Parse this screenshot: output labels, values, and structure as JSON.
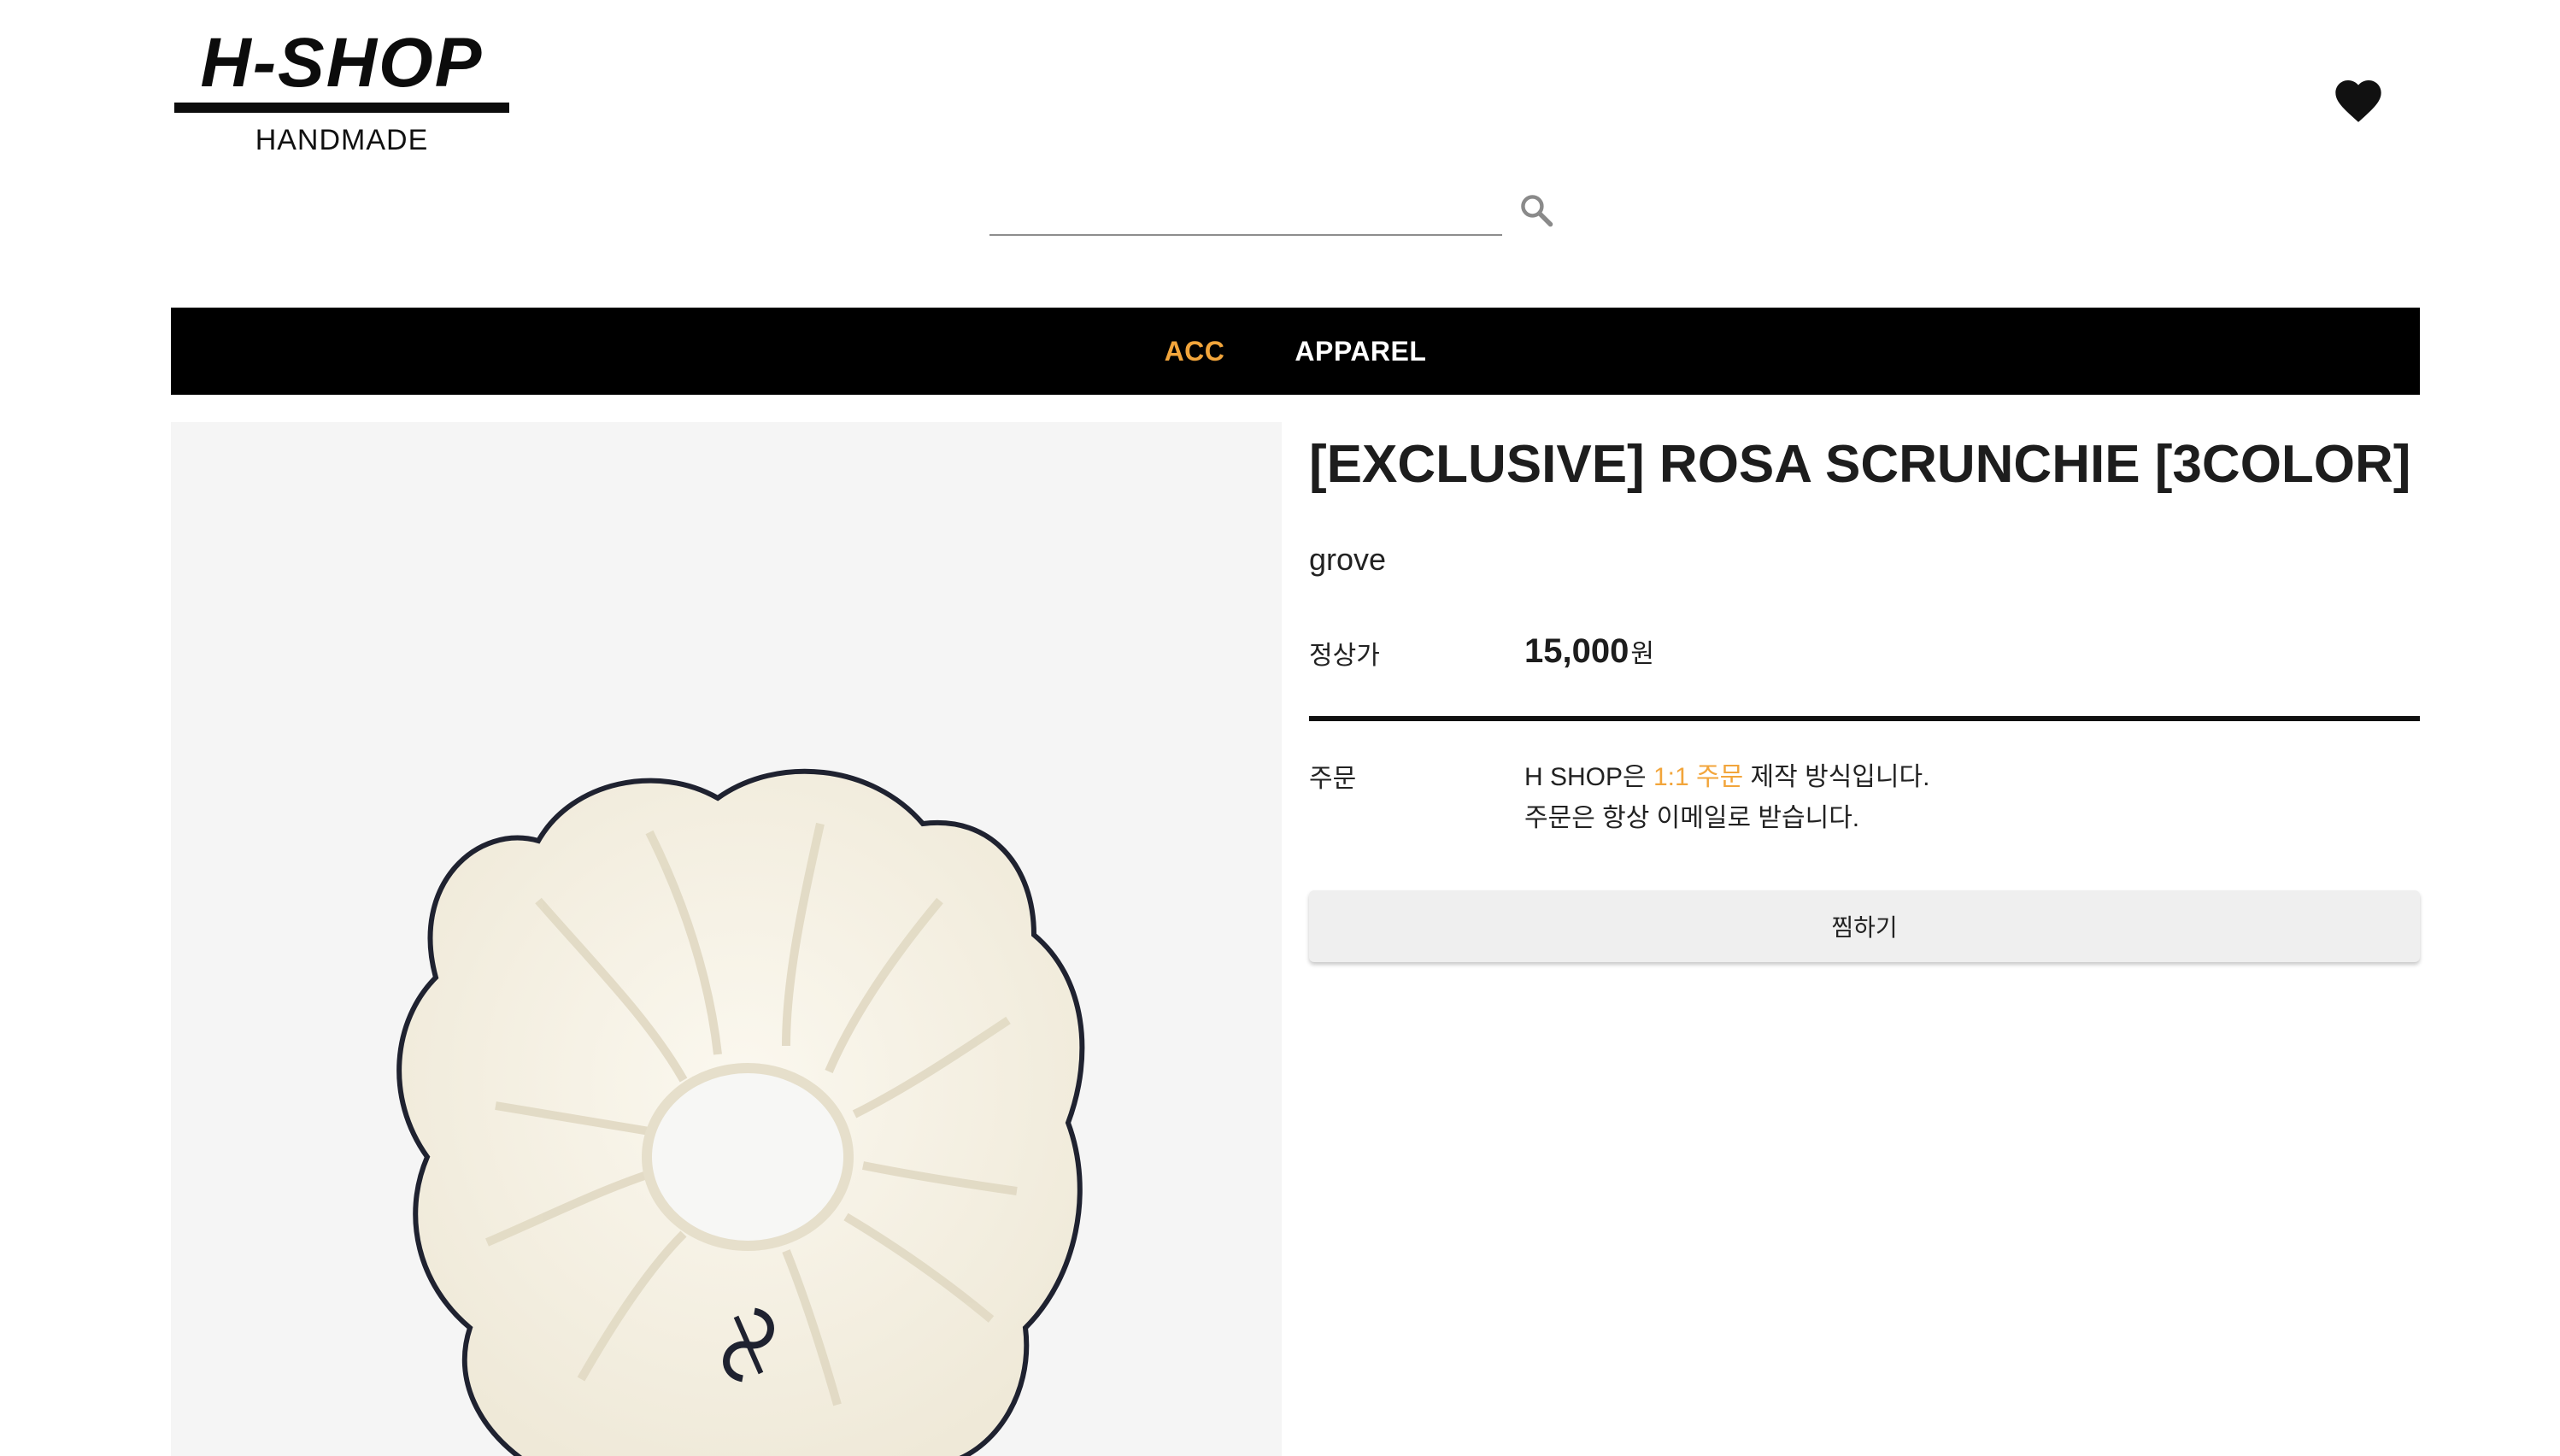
{
  "header": {
    "logo_title": "H-SHOP",
    "logo_subtitle": "HANDMADE",
    "wishlist_icon": "heart-icon"
  },
  "search": {
    "value": "",
    "placeholder": "",
    "icon": "search-icon"
  },
  "nav": {
    "items": [
      {
        "label": "ACC",
        "active": true
      },
      {
        "label": "APPAREL",
        "active": false
      }
    ]
  },
  "product": {
    "title": "[EXCLUSIVE] ROSA SCRUNCHIE [3COLOR]",
    "brand": "grove",
    "price_label": "정상가",
    "price": "15,000",
    "price_unit": "원",
    "order_label": "주문",
    "order_line1_pre": "H SHOP은 ",
    "order_line1_highlight": "1:1 주문",
    "order_line1_post": " 제작 방식입니다.",
    "order_line2": "주문은 항상 이메일로 받습니다.",
    "wish_button": "찜하기"
  },
  "colors": {
    "accent": "#f2a53b",
    "nav_background": "#000000",
    "image_background": "#f5f5f5",
    "button_background": "#efefef"
  }
}
